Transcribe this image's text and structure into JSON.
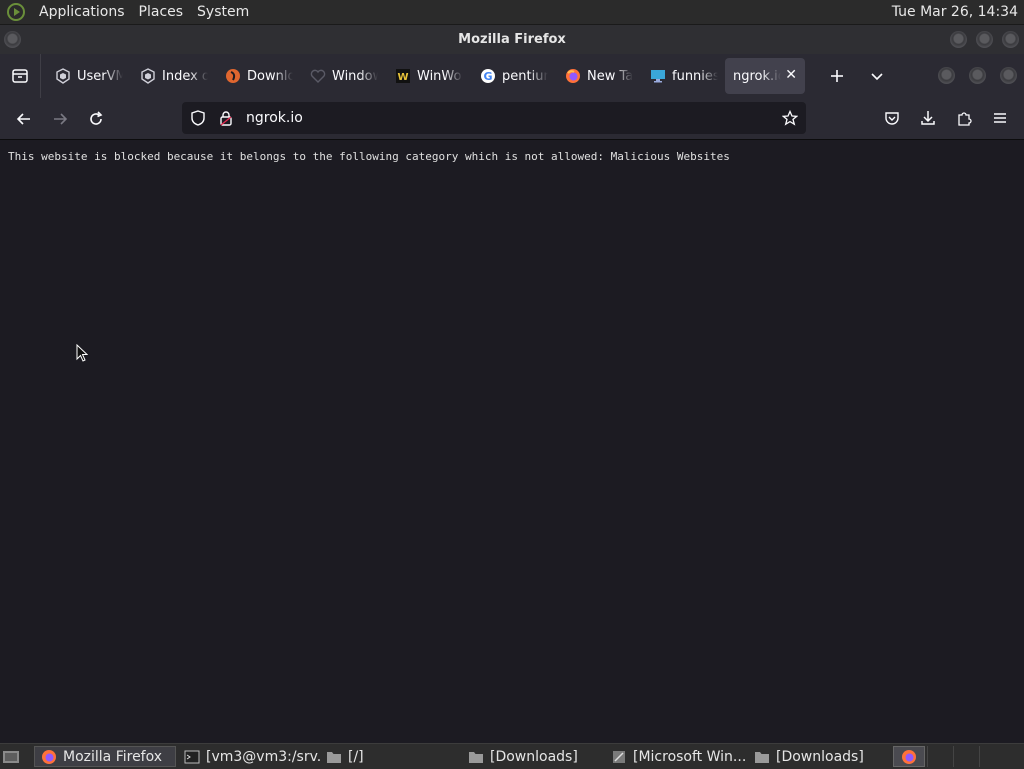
{
  "top_panel": {
    "menus": [
      "Applications",
      "Places",
      "System"
    ],
    "clock": "Tue Mar 26, 14:34"
  },
  "window": {
    "title": "Mozilla Firefox"
  },
  "tabs": [
    {
      "label": "UserVM",
      "icon": "vm-icon"
    },
    {
      "label": "Index of",
      "icon": "vm-icon"
    },
    {
      "label": "Download",
      "icon": "download-site-icon"
    },
    {
      "label": "Windows",
      "icon": "heart-icon"
    },
    {
      "label": "WinWorld",
      "icon": "winworld-icon"
    },
    {
      "label": "pentium",
      "icon": "google-icon"
    },
    {
      "label": "New Tab",
      "icon": "firefox-icon"
    },
    {
      "label": "funniest",
      "icon": "monitor-icon"
    },
    {
      "label": "ngrok.io",
      "icon": "",
      "active": true
    }
  ],
  "navbar": {
    "url": "ngrok.io"
  },
  "content": {
    "message": "This website is blocked because it belongs to the following category which is not allowed: Malicious Websites"
  },
  "taskbar": {
    "items": [
      {
        "label": "Mozilla Firefox",
        "icon": "firefox-icon",
        "active": true
      },
      {
        "label": "[vm3@vm3:/srv...",
        "icon": "terminal-icon"
      },
      {
        "label": "[/]",
        "icon": "folder-icon"
      },
      {
        "label": "[Downloads]",
        "icon": "folder-icon"
      },
      {
        "label": "[Microsoft Win...",
        "icon": "app-icon"
      },
      {
        "label": "[Downloads]",
        "icon": "folder-icon"
      }
    ]
  },
  "colors": {
    "chrome": "#2b2a33",
    "page_bg": "#1c1b22",
    "active_tab": "#42414d"
  }
}
